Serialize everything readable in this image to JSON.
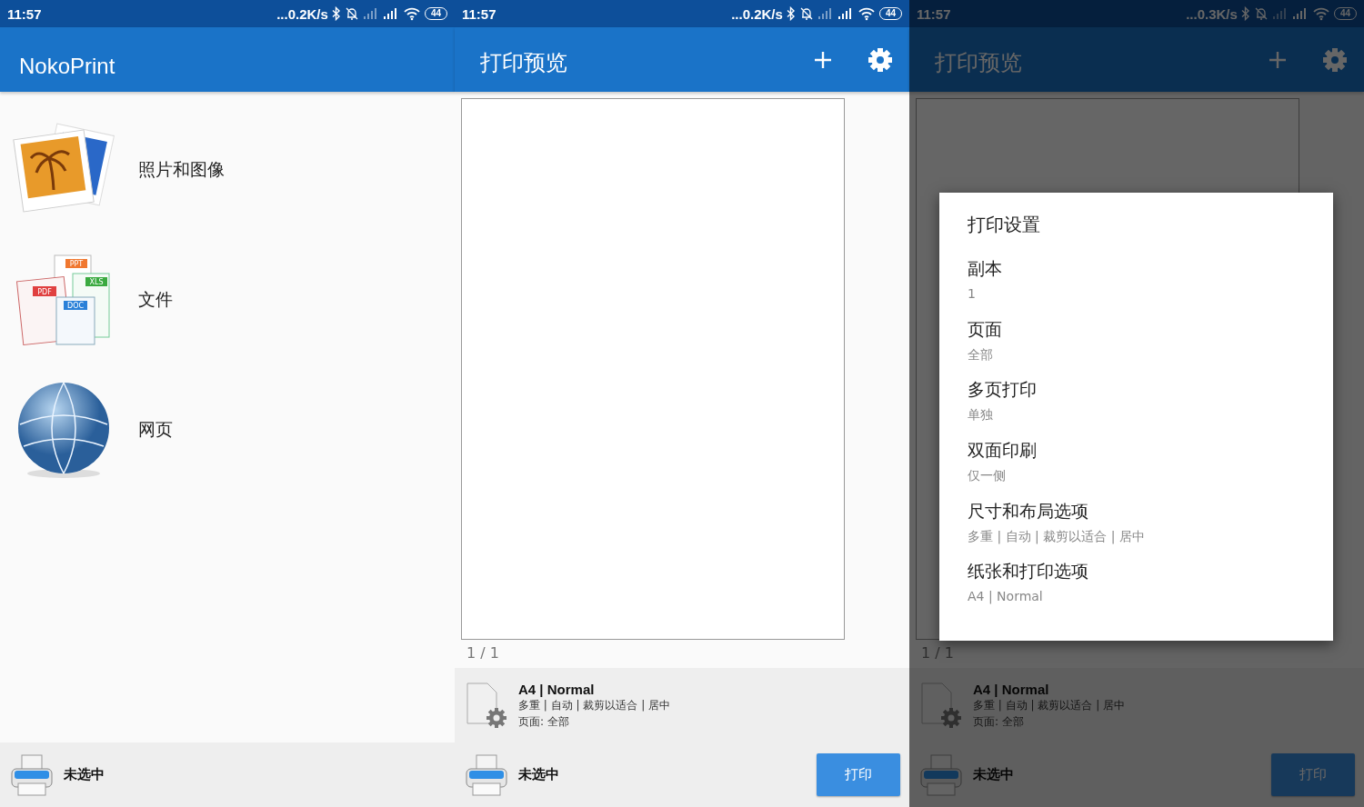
{
  "screens": [
    {
      "kind": "home",
      "status_bar": {
        "time": "11:57",
        "speed": "...0.2K/s",
        "battery": "44"
      },
      "title": "NokoPrint",
      "items": [
        {
          "kind": "photos",
          "label": "照片和图像"
        },
        {
          "kind": "documents",
          "label": "文件",
          "badges": [
            "PPT",
            "XLS",
            "PDF",
            "DOC"
          ]
        },
        {
          "kind": "web",
          "label": "网页"
        }
      ],
      "printer": "未选中"
    },
    {
      "kind": "preview",
      "status_bar": {
        "time": "11:57",
        "speed": "...0.2K/s",
        "battery": "44"
      },
      "title": "打印预览",
      "page_counter": "1 / 1",
      "summary": {
        "title": "A4 | Normal",
        "detail": "多重 | 自动 | 裁剪以适合 | 居中",
        "pages": "页面: 全部"
      },
      "printer": "未选中",
      "print_button": "打印"
    },
    {
      "kind": "preview",
      "status_bar": {
        "time": "11:57",
        "speed": "...0.3K/s",
        "battery": "44"
      },
      "title": "打印预览",
      "page_counter": "1 / 1",
      "summary": {
        "title": "A4 | Normal",
        "detail": "多重 | 自动 | 裁剪以适合 | 居中",
        "pages": "页面: 全部"
      },
      "printer": "未选中",
      "print_button": "打印",
      "dialog": {
        "title": "打印设置",
        "options": [
          {
            "label": "副本",
            "value": "1"
          },
          {
            "label": "页面",
            "value": "全部"
          },
          {
            "label": "多页打印",
            "value": "单独"
          },
          {
            "label": "双面印刷",
            "value": "仅一侧"
          },
          {
            "label": "尺寸和布局选项",
            "value": "多重 | 自动 | 裁剪以适合 | 居中"
          },
          {
            "label": "纸张和打印选项",
            "value": "A4 | Normal"
          }
        ]
      }
    }
  ]
}
